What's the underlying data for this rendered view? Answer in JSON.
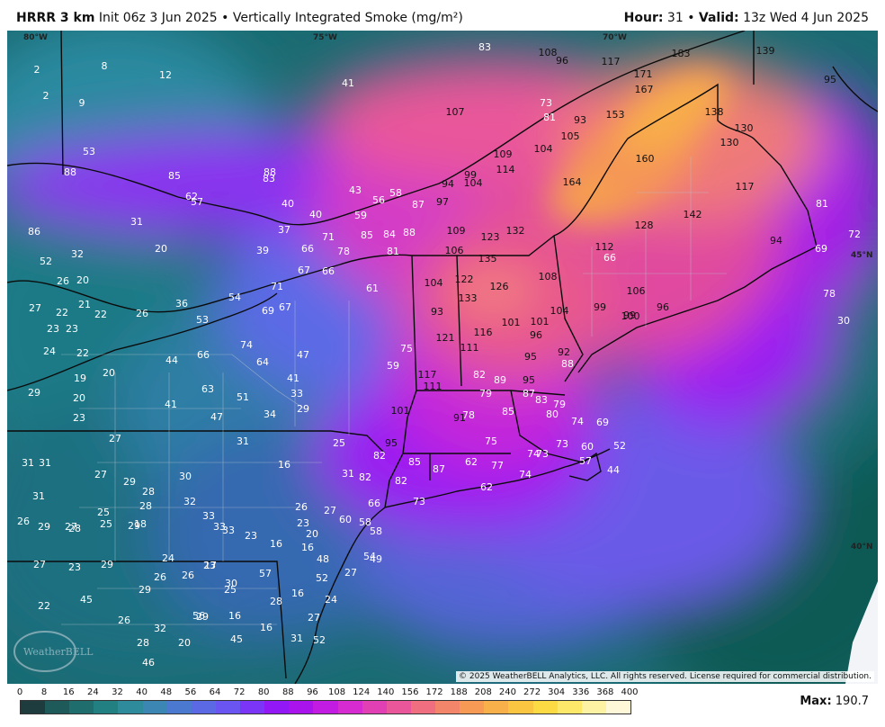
{
  "header": {
    "model": "HRRR 3 km",
    "init": "Init 06z 3 Jun 2025",
    "separator": "•",
    "product": "Vertically Integrated Smoke (mg/m²)",
    "hour_label": "Hour:",
    "hour_value": "31",
    "valid_label": "Valid:",
    "valid_value": "13z Wed 4 Jun 2025"
  },
  "map": {
    "copyright": "© 2025 WeatherBELL Analytics, LLC. All rights reserved. License required for commercial distribution.",
    "watermark": "WeatherBELL",
    "coord_labels": [
      "80°W",
      "75°W",
      "70°W",
      "45°N",
      "40°N"
    ],
    "values": [
      "2",
      "8",
      "12",
      "41",
      "83",
      "108",
      "96",
      "117",
      "171",
      "183",
      "139",
      "95",
      "2",
      "9",
      "107",
      "73",
      "81",
      "93",
      "153",
      "167",
      "138",
      "130",
      "130",
      "53",
      "109",
      "114",
      "104",
      "105",
      "99",
      "104",
      "160",
      "88",
      "85",
      "88",
      "83",
      "43",
      "58",
      "94",
      "97",
      "164",
      "117",
      "62",
      "57",
      "40",
      "40",
      "56",
      "87",
      "59",
      "142",
      "81",
      "31",
      "37",
      "71",
      "85",
      "84",
      "88",
      "109",
      "123",
      "132",
      "128",
      "86",
      "20",
      "39",
      "66",
      "78",
      "81",
      "106",
      "135",
      "112",
      "94",
      "72",
      "52",
      "32",
      "67",
      "66",
      "122",
      "126",
      "108",
      "66",
      "69",
      "26",
      "20",
      "71",
      "61",
      "104",
      "133",
      "106",
      "78",
      "27",
      "22",
      "21",
      "22",
      "26",
      "36",
      "54",
      "69",
      "67",
      "93",
      "101",
      "104",
      "99",
      "99",
      "100",
      "96",
      "30",
      "23",
      "23",
      "53",
      "121",
      "111",
      "116",
      "96",
      "101",
      "24",
      "22",
      "66",
      "74",
      "64",
      "47",
      "75",
      "59",
      "95",
      "92",
      "88",
      "19",
      "20",
      "44",
      "41",
      "117",
      "82",
      "89",
      "95",
      "29",
      "20",
      "63",
      "51",
      "33",
      "111",
      "79",
      "87",
      "83",
      "79",
      "23",
      "41",
      "47",
      "34",
      "29",
      "101",
      "91",
      "78",
      "85",
      "80",
      "74",
      "69",
      "31",
      "27",
      "31",
      "25",
      "82",
      "75",
      "73",
      "60",
      "52",
      "31",
      "27",
      "29",
      "30",
      "28",
      "25",
      "95",
      "85",
      "87",
      "62",
      "77",
      "74",
      "74",
      "73",
      "57",
      "44",
      "31",
      "28",
      "32",
      "16",
      "31",
      "82",
      "82",
      "62",
      "29",
      "28",
      "18",
      "26",
      "27",
      "66",
      "73",
      "26",
      "27",
      "25",
      "29",
      "33",
      "33",
      "33",
      "23",
      "16",
      "23",
      "60",
      "58",
      "16",
      "20",
      "58",
      "27",
      "23",
      "29",
      "24",
      "23",
      "48",
      "54",
      "49",
      "29",
      "26",
      "26",
      "17",
      "57",
      "52",
      "27",
      "30",
      "25",
      "22",
      "16",
      "45",
      "24",
      "26",
      "32",
      "29",
      "56",
      "27",
      "16",
      "16",
      "28",
      "28",
      "20",
      "45",
      "52",
      "31",
      "46"
    ]
  },
  "legend": {
    "ticks": [
      "0",
      "8",
      "16",
      "24",
      "32",
      "40",
      "48",
      "56",
      "64",
      "72",
      "80",
      "88",
      "96",
      "108",
      "124",
      "140",
      "156",
      "172",
      "188",
      "208",
      "240",
      "272",
      "304",
      "336",
      "368",
      "400"
    ],
    "colors": [
      "#1e3b3d",
      "#1d5a59",
      "#1f6d6d",
      "#227f82",
      "#2d8b9c",
      "#3c86b4",
      "#4a79cf",
      "#5b69e5",
      "#6a55f2",
      "#7b35f6",
      "#9219f5",
      "#aa14ec",
      "#c21be1",
      "#d52bd0",
      "#e040b4",
      "#e9569a",
      "#ef6e80",
      "#f3856a",
      "#f69a56",
      "#f8b04a",
      "#fac540",
      "#fcda44",
      "#fde86a",
      "#fdf1a4",
      "#fef8d8",
      "#ffffff"
    ],
    "max_label": "Max:",
    "max_value": "190.7"
  }
}
